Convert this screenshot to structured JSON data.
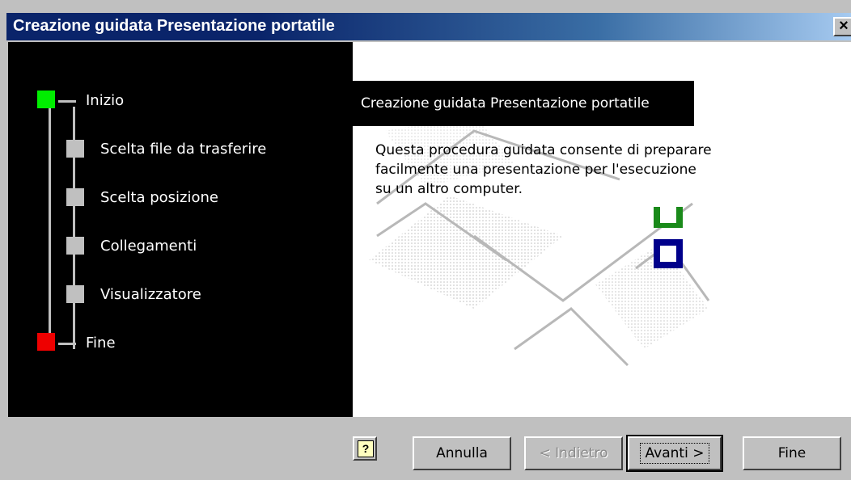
{
  "window": {
    "title": "Creazione guidata Presentazione portatile",
    "close_symbol": "×"
  },
  "steps": [
    {
      "label": "Inizio",
      "status": "current",
      "color": "#00ee00"
    },
    {
      "label": "Scelta file da trasferire",
      "status": "pending",
      "color": "#c0c0c0"
    },
    {
      "label": "Scelta posizione",
      "status": "pending",
      "color": "#c0c0c0"
    },
    {
      "label": "Collegamenti",
      "status": "pending",
      "color": "#c0c0c0"
    },
    {
      "label": "Visualizzatore",
      "status": "pending",
      "color": "#c0c0c0"
    },
    {
      "label": "Fine",
      "status": "end",
      "color": "#ee0000"
    }
  ],
  "content": {
    "header": "Creazione guidata Presentazione portatile",
    "description": "Questa procedura guidata consente di preparare facilmente una presentazione per l'esecuzione su un altro computer."
  },
  "buttons": {
    "help_icon": "?",
    "cancel": "Annulla",
    "back": "< Indietro",
    "next": "Avanti >",
    "finish": "Fine"
  },
  "colors": {
    "titlebar": "#0a246a",
    "deco_green": "#1a8a1a",
    "deco_blue": "#00008b"
  }
}
